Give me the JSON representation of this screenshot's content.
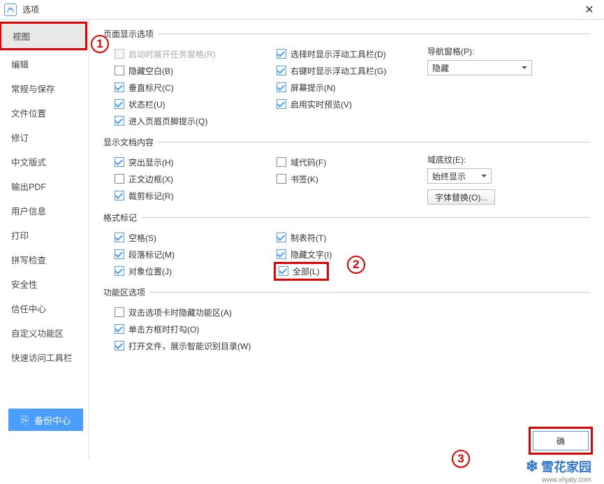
{
  "title": "选项",
  "sidebar": {
    "items": [
      {
        "label": "视图",
        "active": true
      },
      {
        "label": "编辑"
      },
      {
        "label": "常规与保存"
      },
      {
        "label": "文件位置"
      },
      {
        "label": "修订"
      },
      {
        "label": "中文版式"
      },
      {
        "label": "输出PDF"
      },
      {
        "label": "用户信息"
      },
      {
        "label": "打印"
      },
      {
        "label": "拼写检查"
      },
      {
        "label": "安全性"
      },
      {
        "label": "信任中心"
      },
      {
        "label": "自定义功能区"
      },
      {
        "label": "快速访问工具栏"
      }
    ]
  },
  "groups": {
    "page_display": {
      "title": "页面显示选项",
      "left": [
        {
          "label": "启动时展开任务窗格(R)",
          "checked": false,
          "disabled": true
        },
        {
          "label": "隐藏空白(B)",
          "checked": false
        },
        {
          "label": "垂直标尺(C)",
          "checked": true
        },
        {
          "label": "状态栏(U)",
          "checked": true
        },
        {
          "label": "进入页眉页脚提示(Q)",
          "checked": true
        }
      ],
      "mid": [
        {
          "label": "选择时显示浮动工具栏(D)",
          "checked": true
        },
        {
          "label": "右键时显示浮动工具栏(G)",
          "checked": true
        },
        {
          "label": "屏幕提示(N)",
          "checked": true
        },
        {
          "label": "启用实时预览(V)",
          "checked": true
        }
      ],
      "nav_label": "导航窗格(P):",
      "nav_value": "隐藏"
    },
    "doc_content": {
      "title": "显示文档内容",
      "left": [
        {
          "label": "突出显示(H)",
          "checked": true
        },
        {
          "label": "正文边框(X)",
          "checked": false
        },
        {
          "label": "裁剪标记(R)",
          "checked": true
        }
      ],
      "mid": [
        {
          "label": "域代码(F)",
          "checked": false
        },
        {
          "label": "书签(K)",
          "checked": false
        }
      ],
      "shade_label": "域底纹(E):",
      "shade_value": "始终显示",
      "font_sub_btn": "字体替换(O)..."
    },
    "format_marks": {
      "title": "格式标记",
      "left": [
        {
          "label": "空格(S)",
          "checked": true
        },
        {
          "label": "段落标记(M)",
          "checked": true
        },
        {
          "label": "对象位置(J)",
          "checked": true
        }
      ],
      "mid": [
        {
          "label": "制表符(T)",
          "checked": true
        },
        {
          "label": "隐藏文字(I)",
          "checked": true
        },
        {
          "label": "全部(L)",
          "checked": true
        }
      ]
    },
    "ribbon": {
      "title": "功能区选项",
      "items": [
        {
          "label": "双击选项卡时隐藏功能区(A)",
          "checked": false
        },
        {
          "label": "单击方框时打勾(O)",
          "checked": true
        },
        {
          "label": "打开文件，展示智能识别目录(W)",
          "checked": true
        }
      ]
    }
  },
  "backup_label": "备份中心",
  "ok_label": "确",
  "watermark": {
    "text": "雪花家园",
    "url": "www.xhjaty.com"
  },
  "annotations": {
    "one": "1",
    "two": "2",
    "three": "3"
  }
}
